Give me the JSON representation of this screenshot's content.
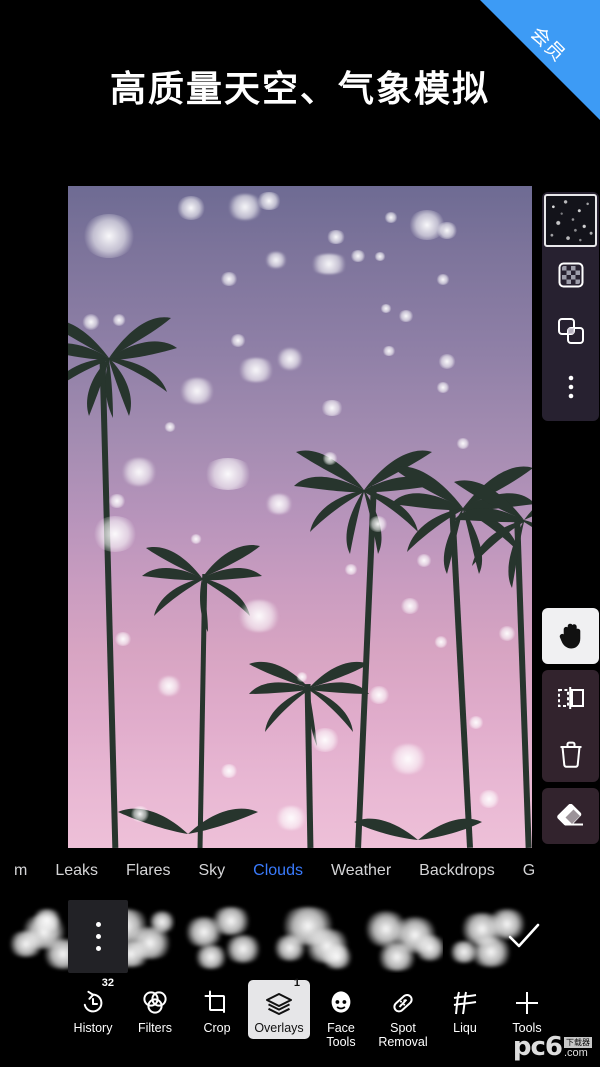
{
  "ribbon": {
    "label": "会员",
    "color": "#3d9bf5"
  },
  "headline": {
    "text": "高质量天空、气象模拟"
  },
  "canvas": {
    "name": "palm-trees-pink-sky-photo",
    "description": "Palm tree silhouettes against a purple-to-pink gradient sky with white bokeh snow overlay"
  },
  "layer_panel": {
    "thumbnail_name": "overlay-layer-thumbnail",
    "buttons": [
      {
        "name": "blend-mode-button",
        "icon": "checkerboard-icon"
      },
      {
        "name": "duplicate-layer-button",
        "icon": "duplicate-layers-icon"
      },
      {
        "name": "layer-more-button",
        "icon": "more-vertical-icon"
      }
    ]
  },
  "tool_panel": {
    "buttons": [
      {
        "name": "pan-tool-button",
        "icon": "hand-icon",
        "active": true
      },
      {
        "name": "flip-tool-button",
        "icon": "flip-horizontal-icon",
        "active": false
      },
      {
        "name": "delete-tool-button",
        "icon": "trash-icon",
        "active": false
      },
      {
        "name": "eraser-tool-button",
        "icon": "eraser-icon",
        "active": false
      }
    ]
  },
  "tabs": {
    "items": [
      {
        "label": "m",
        "active": false
      },
      {
        "label": "Leaks",
        "active": false
      },
      {
        "label": "Flares",
        "active": false
      },
      {
        "label": "Sky",
        "active": false
      },
      {
        "label": "Clouds",
        "active": true
      },
      {
        "label": "Weather",
        "active": false
      },
      {
        "label": "Backdrops",
        "active": false
      },
      {
        "label": "G",
        "active": false
      }
    ],
    "active_color": "#3a7bfd"
  },
  "overlay_strip": {
    "more_button": "more-overlays-button",
    "apply_button": "apply-checkmark-button",
    "thumbnails": [
      {
        "name": "cloud-overlay-thumbnail-1"
      },
      {
        "name": "cloud-overlay-thumbnail-2"
      },
      {
        "name": "cloud-overlay-thumbnail-3"
      },
      {
        "name": "cloud-overlay-thumbnail-4"
      },
      {
        "name": "cloud-overlay-thumbnail-5"
      },
      {
        "name": "cloud-overlay-thumbnail-6"
      }
    ]
  },
  "bottom_bar": {
    "items": [
      {
        "label": "History",
        "icon": "undo-history-icon",
        "badge": "32",
        "active": false
      },
      {
        "label": "Filters",
        "icon": "filters-circles-icon",
        "badge": "",
        "active": false
      },
      {
        "label": "Crop",
        "icon": "crop-icon",
        "badge": "",
        "active": false
      },
      {
        "label": "Overlays",
        "icon": "layers-icon",
        "badge": "1",
        "active": true
      },
      {
        "label": "Face\nTools",
        "icon": "face-icon",
        "badge": "",
        "active": false
      },
      {
        "label": "Spot\nRemoval",
        "icon": "bandage-icon",
        "badge": "",
        "active": false
      },
      {
        "label": "Liqu",
        "icon": "liquify-grid-icon",
        "badge": "",
        "active": false
      },
      {
        "label": "Tools",
        "icon": "plus-icon",
        "badge": "",
        "active": false
      }
    ]
  },
  "watermark": {
    "brand": "pc6",
    "suffix": "6",
    "box": "下载器",
    "domain": ".com"
  }
}
